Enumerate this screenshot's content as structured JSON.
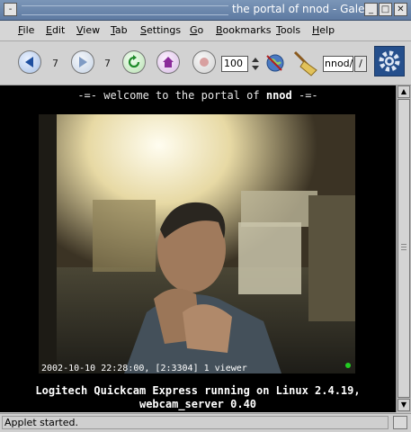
{
  "window": {
    "title": "the portal of nnod - Galeon",
    "menu_button": "-",
    "minimize": "_",
    "maximize": "□",
    "close": "✕"
  },
  "menubar": {
    "items": [
      {
        "label": "File",
        "mnemonic_index": 0
      },
      {
        "label": "Edit",
        "mnemonic_index": 0
      },
      {
        "label": "View",
        "mnemonic_index": 0
      },
      {
        "label": "Tab",
        "mnemonic_index": 0
      },
      {
        "label": "Settings",
        "mnemonic_index": 0
      },
      {
        "label": "Go",
        "mnemonic_index": 0
      },
      {
        "label": "Bookmarks",
        "mnemonic_index": 0
      },
      {
        "label": "Tools",
        "mnemonic_index": 0
      },
      {
        "label": "Help",
        "mnemonic_index": 0
      }
    ]
  },
  "toolbar": {
    "back_history": "7",
    "forward_history": "7",
    "zoom_value": "100",
    "url_value": "nnod/",
    "go_label": "/"
  },
  "page": {
    "welcome_prefix": "-=- welcome to the portal of ",
    "welcome_name": "nnod",
    "welcome_suffix": " -=-",
    "cam_overlay": "2002-10-10 22:28:00, [2:3304] 1 viewer",
    "caption_line1": "Logitech Quickcam Express running on Linux 2.4.19,",
    "caption_line2": "webcam_server 0.40"
  },
  "statusbar": {
    "text": "Applet started."
  },
  "colors": {
    "titlebar": "#6a86ad",
    "content_bg": "#000000",
    "overlay_dot": "#22cc22"
  }
}
